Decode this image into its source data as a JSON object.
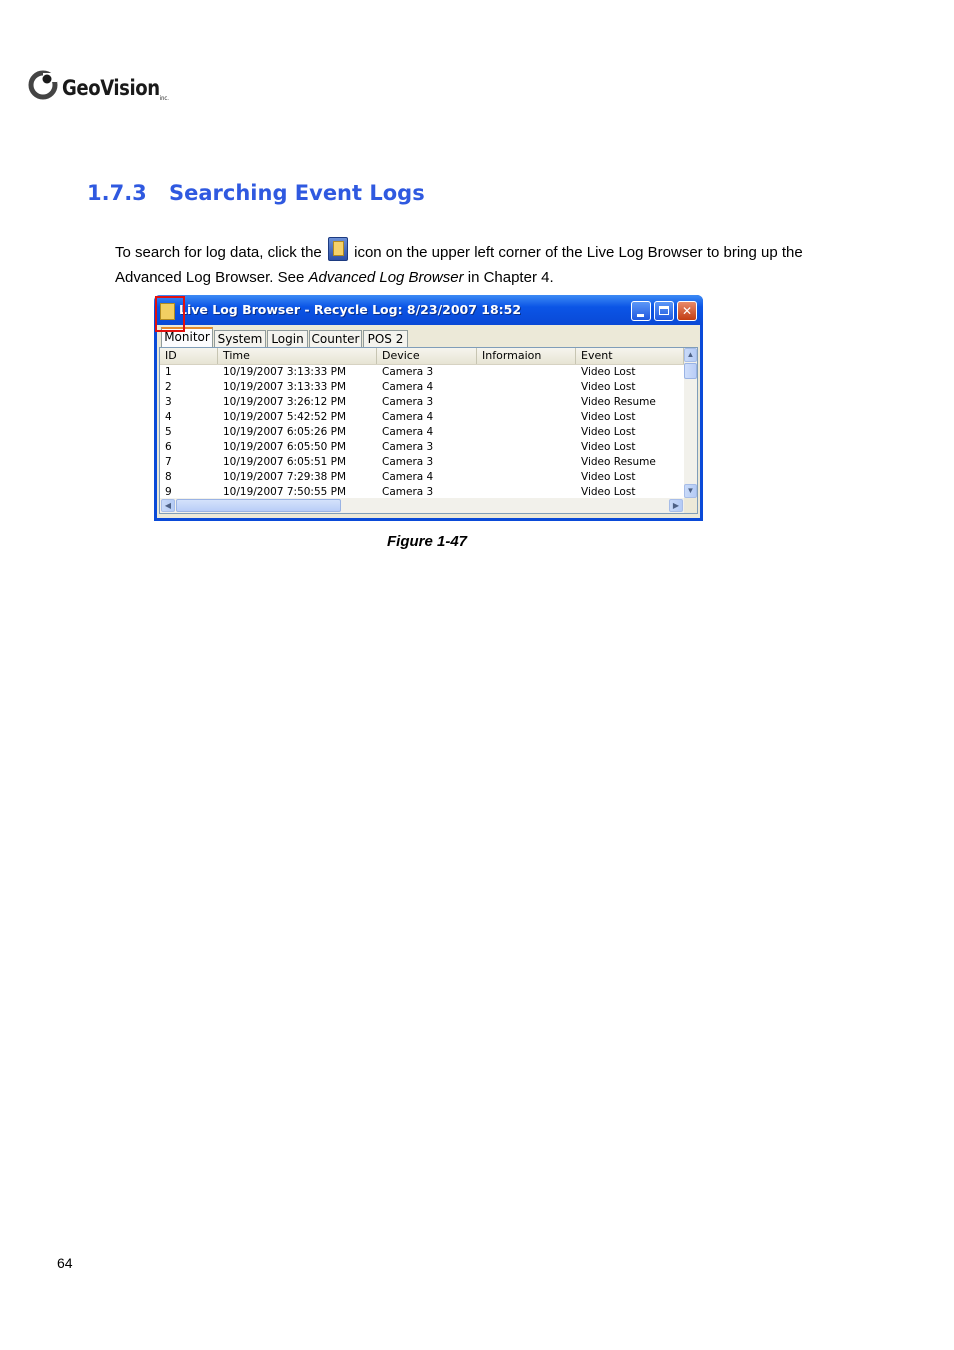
{
  "logo": {
    "text": "GeoVision",
    "sub": "inc."
  },
  "section": {
    "number": "1.7.3",
    "title": "Searching Event Logs"
  },
  "paragraph": {
    "part1": "To search for log data, click the",
    "part2": "icon on the upper left corner of the Live Log Browser to bring up the Advanced Log Browser. See",
    "emphasis": "Advanced Log Browser",
    "part3": "in Chapter 4."
  },
  "window": {
    "title": "Live Log Browser  -  Recycle Log: 8/23/2007 18:52",
    "tabs": [
      "Monitor",
      "System",
      "Login",
      "Counter",
      "POS 2"
    ],
    "active_tab": "Monitor",
    "columns": [
      "ID",
      "Time",
      "Device",
      "Informaion",
      "Event"
    ],
    "rows": [
      [
        "1",
        "10/19/2007 3:13:33 PM",
        "Camera 3",
        "",
        "Video Lost"
      ],
      [
        "2",
        "10/19/2007 3:13:33 PM",
        "Camera 4",
        "",
        "Video Lost"
      ],
      [
        "3",
        "10/19/2007 3:26:12 PM",
        "Camera 3",
        "",
        "Video Resume"
      ],
      [
        "4",
        "10/19/2007 5:42:52 PM",
        "Camera 4",
        "",
        "Video Lost"
      ],
      [
        "5",
        "10/19/2007 6:05:26 PM",
        "Camera 4",
        "",
        "Video Lost"
      ],
      [
        "6",
        "10/19/2007 6:05:50 PM",
        "Camera 3",
        "",
        "Video Lost"
      ],
      [
        "7",
        "10/19/2007 6:05:51 PM",
        "Camera 3",
        "",
        "Video Resume"
      ],
      [
        "8",
        "10/19/2007 7:29:38 PM",
        "Camera 4",
        "",
        "Video Lost"
      ],
      [
        "9",
        "10/19/2007 7:50:55 PM",
        "Camera 3",
        "",
        "Video Lost"
      ]
    ],
    "icons": {
      "window_icon": "log-browser-icon",
      "minimize": "minimize-icon",
      "maximize": "maximize-icon",
      "close": "close-icon"
    }
  },
  "caption": "Figure 1-47",
  "page_number": "64",
  "colors": {
    "heading": "#2f59e0",
    "titlebar": "#0a49d6",
    "highlight": "#e01010"
  }
}
